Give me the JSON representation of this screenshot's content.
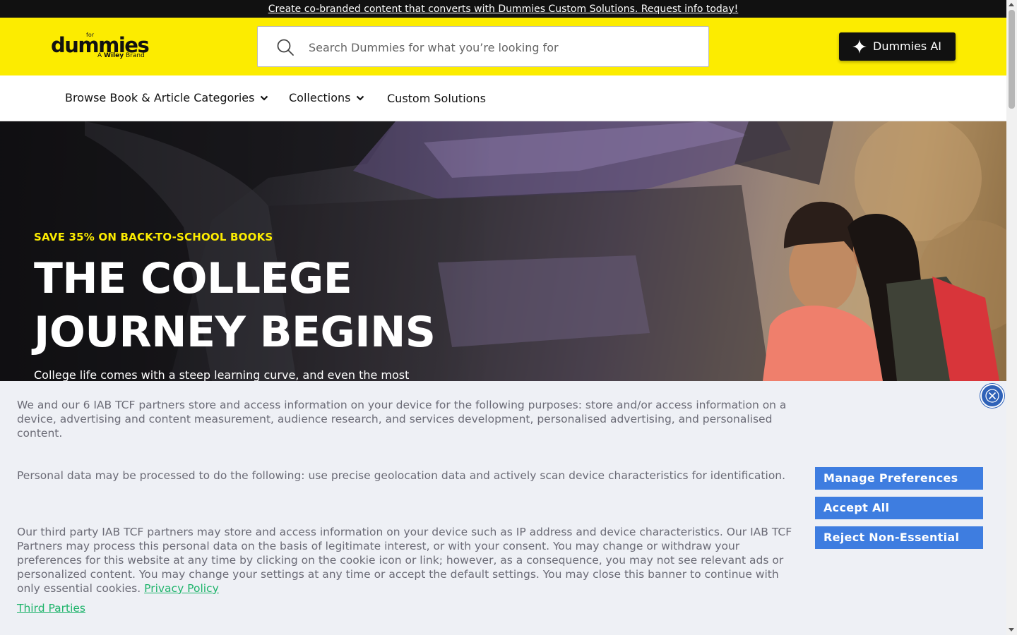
{
  "promo": {
    "text": "Create co-branded content that converts with Dummies Custom Solutions. Request info today!"
  },
  "header": {
    "logo": {
      "for_text": "for",
      "wordmark": "dummies",
      "brand_prefix": "A",
      "brand_name": "Wiley",
      "brand_suffix": "Brand"
    },
    "search": {
      "placeholder": "Search Dummies for what you’re looking for",
      "icon": "search-icon"
    },
    "ai_button": {
      "label": "Dummies AI",
      "icon": "sparkle-icon"
    },
    "background_color": "#fcec00"
  },
  "nav": {
    "items": [
      {
        "label": "Browse Book & Article Categories",
        "has_dropdown": true
      },
      {
        "label": "Collections",
        "has_dropdown": true
      },
      {
        "label": "Custom Solutions",
        "has_dropdown": false
      }
    ]
  },
  "hero": {
    "eyebrow": "SAVE 35% ON BACK-TO-SCHOOL BOOKS",
    "title": "THE COLLEGE JOURNEY BEGINS",
    "description": "College life comes with a steep learning curve, and even the most",
    "eyebrow_color": "#fcec00"
  },
  "cookie_banner": {
    "paragraph_1": "We and our 6 IAB TCF partners store and access information on your device for the following purposes: store and/or access information on a device, advertising and content measurement, audience research, and services development, personalised advertising, and personalised content.",
    "paragraph_2": "Personal data may be processed to do the following: use precise geolocation data and actively scan device characteristics for identification.",
    "paragraph_3": "Our third party IAB TCF partners may store and access information on your device such as IP address and device characteristics. Our IAB TCF Partners may process this personal data on the basis of legitimate interest, or with your consent. You may change or withdraw your preferences for this website at any time by clicking on the cookie icon or link; however, as a consequence, you may not see relevant ads or personalized content. You may change your settings at any time or accept the default settings. You may close this banner to continue with only essential cookies.",
    "privacy_link": "Privacy Policy",
    "third_parties_link": "Third Parties",
    "buttons": {
      "manage": "Manage Preferences",
      "accept": "Accept All",
      "reject": "Reject Non-Essential"
    },
    "button_color": "#3e7de0",
    "link_color": "#1eb46b",
    "close_icon": "close-icon"
  }
}
